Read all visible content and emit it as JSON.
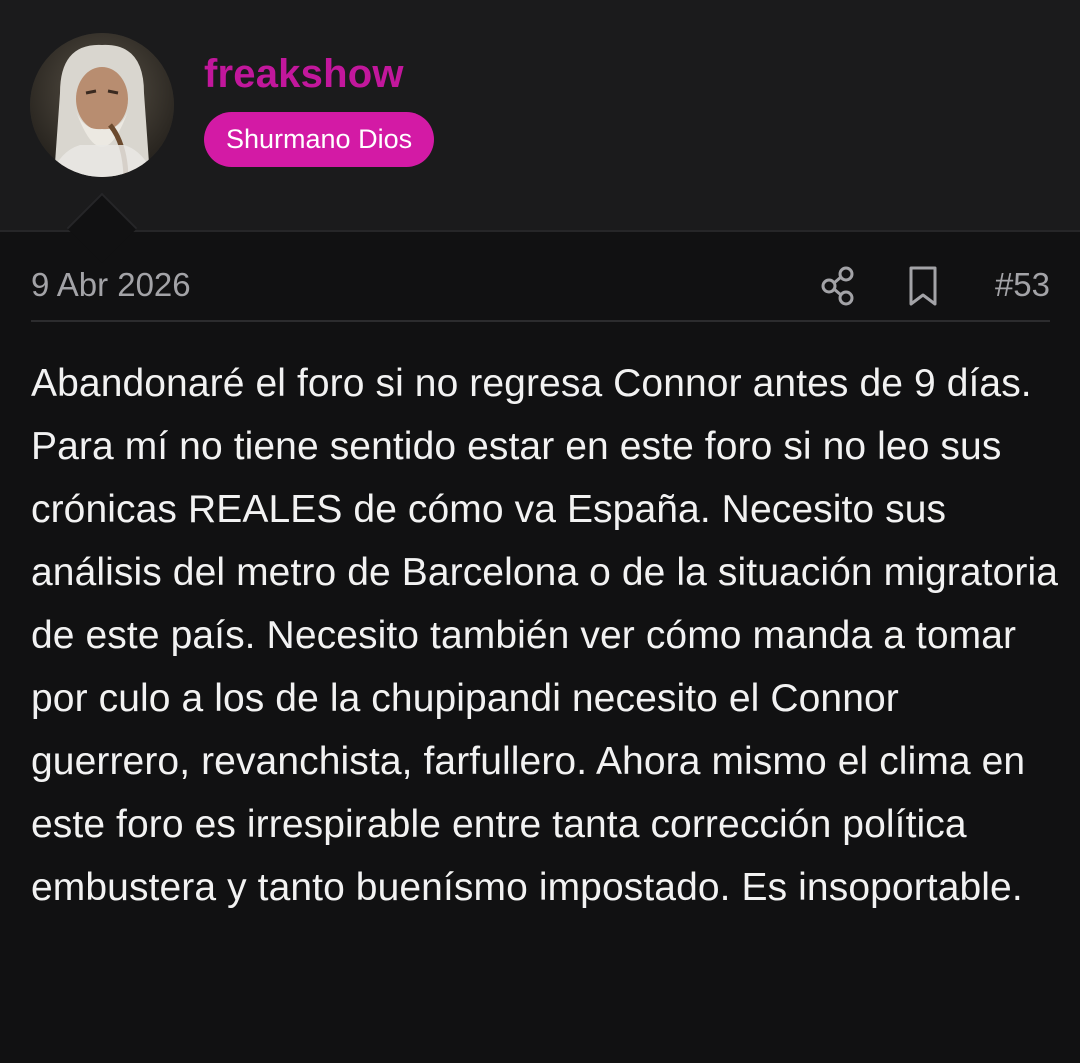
{
  "author": {
    "username": "freakshow",
    "user_title": "Shurmano Dios",
    "avatar_icon": "wizard-avatar",
    "username_color": "#c2179c",
    "title_badge_color": "#d31aa5"
  },
  "post": {
    "date": "9 Abr 2026",
    "number": "#53",
    "share_icon": "share-icon",
    "bookmark_icon": "bookmark-icon",
    "body": "Abandonaré el foro si no regresa Connor antes de 9 días. Para mí no tiene sentido estar en este foro si no leo sus crónicas REALES de cómo va España. Necesito sus análisis del metro de Barcelona o de la situación migratoria de este país. Necesito también ver cómo manda a tomar por culo a los de la chupipandi necesito el Connor guerrero, revanchista, farfullero. Ahora mismo el clima en este foro es irrespirable entre tanta corrección política embustera y tanto buenísmo impostado. Es insoportable."
  }
}
